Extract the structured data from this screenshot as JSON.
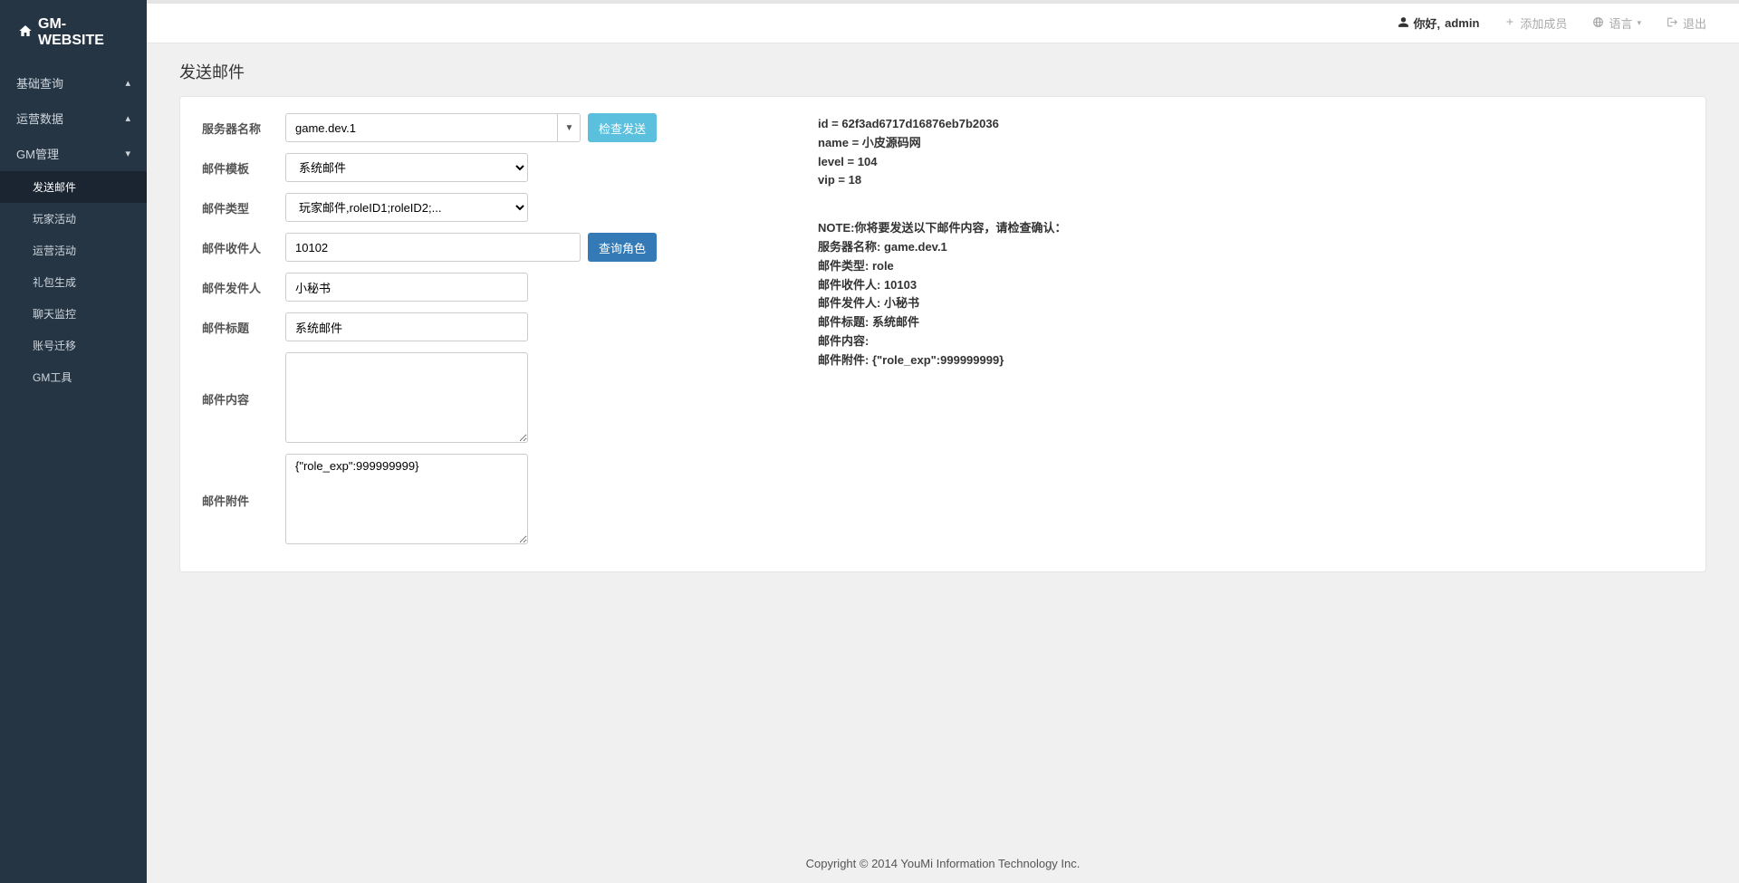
{
  "brand": {
    "name": "GM-WEBSITE",
    "icon": "home-icon"
  },
  "sidebar": {
    "sections": [
      {
        "label": "基础查询",
        "expanded": false
      },
      {
        "label": "运营数据",
        "expanded": false
      },
      {
        "label": "GM管理",
        "expanded": true,
        "items": [
          {
            "label": "发送邮件",
            "active": true
          },
          {
            "label": "玩家活动"
          },
          {
            "label": "运营活动"
          },
          {
            "label": "礼包生成"
          },
          {
            "label": "聊天监控"
          },
          {
            "label": "账号迁移"
          },
          {
            "label": "GM工具"
          }
        ]
      }
    ]
  },
  "topbar": {
    "greeting_prefix": "你好,",
    "user": "admin",
    "add_member": "添加成员",
    "language": "语言",
    "logout": "退出"
  },
  "page": {
    "title": "发送邮件"
  },
  "form": {
    "server_label": "服务器名称",
    "server_value": "game.dev.1",
    "check_send_btn": "检查发送",
    "template_label": "邮件模板",
    "template_value": "系统邮件",
    "type_label": "邮件类型",
    "type_value": "玩家邮件,roleID1;roleID2;...",
    "recipient_label": "邮件收件人",
    "recipient_value": "10102",
    "query_role_btn": "查询角色",
    "sender_label": "邮件发件人",
    "sender_value": "小秘书",
    "title_label": "邮件标题",
    "title_value": "系统邮件",
    "content_label": "邮件内容",
    "content_value": "",
    "attachment_label": "邮件附件",
    "attachment_value": "{\"role_exp\":999999999}"
  },
  "info": {
    "player": {
      "id_line": "id = 62f3ad6717d16876eb7b2036",
      "name_line": "name = 小皮源码网",
      "level_line": "level = 104",
      "vip_line": "vip = 18"
    },
    "note": {
      "header": "NOTE:你将要发送以下邮件内容，请检查确认：",
      "server": "服务器名称: game.dev.1",
      "type": "邮件类型: role",
      "recipient": "邮件收件人: 10103",
      "sender": "邮件发件人: 小秘书",
      "title": "邮件标题: 系统邮件",
      "content": "邮件内容:",
      "attachment": "邮件附件: {\"role_exp\":999999999}"
    }
  },
  "footer": {
    "text": "Copyright © 2014 YouMi Information Technology Inc."
  }
}
